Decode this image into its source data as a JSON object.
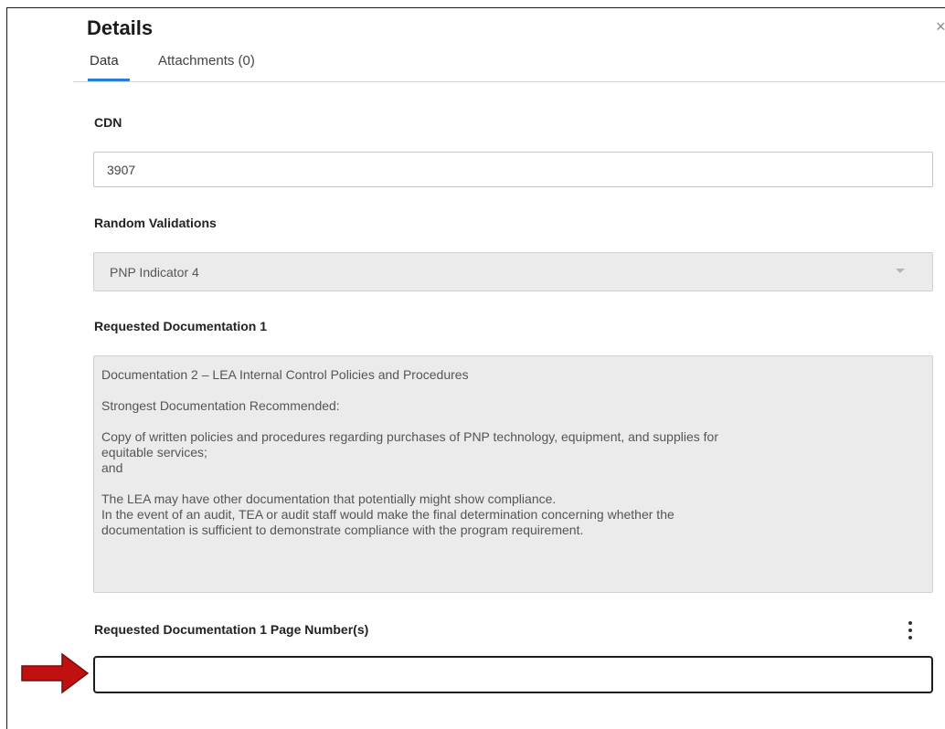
{
  "panel": {
    "title": "Details",
    "close_icon": "×",
    "tabs": [
      {
        "label": "Data",
        "active": true
      },
      {
        "label": "Attachments (0)",
        "active": false
      }
    ]
  },
  "form": {
    "cdn": {
      "label": "CDN",
      "value": "3907"
    },
    "random_validations": {
      "label": "Random Validations",
      "value": "PNP Indicator 4"
    },
    "requested_doc_1": {
      "label": "Requested Documentation 1",
      "lines": [
        "Documentation 2 – LEA Internal Control Policies and Procedures",
        "",
        "Strongest Documentation Recommended:",
        "",
        "Copy of written policies and procedures regarding purchases of PNP technology, equipment, and supplies for",
        "equitable services;",
        "and",
        "",
        "The LEA may have other documentation that potentially might show compliance.",
        "In the event of an audit, TEA or audit staff would make the final determination concerning whether the",
        "documentation is sufficient to demonstrate compliance with the program requirement."
      ]
    },
    "page_numbers": {
      "label": "Requested Documentation 1 Page Number(s)",
      "value": ""
    }
  },
  "colors": {
    "accent": "#2a7fd4",
    "arrow": "#c01010"
  },
  "icons": [
    "close-icon",
    "chevron-down-icon",
    "kebab-menu-icon",
    "arrow-right-icon"
  ]
}
